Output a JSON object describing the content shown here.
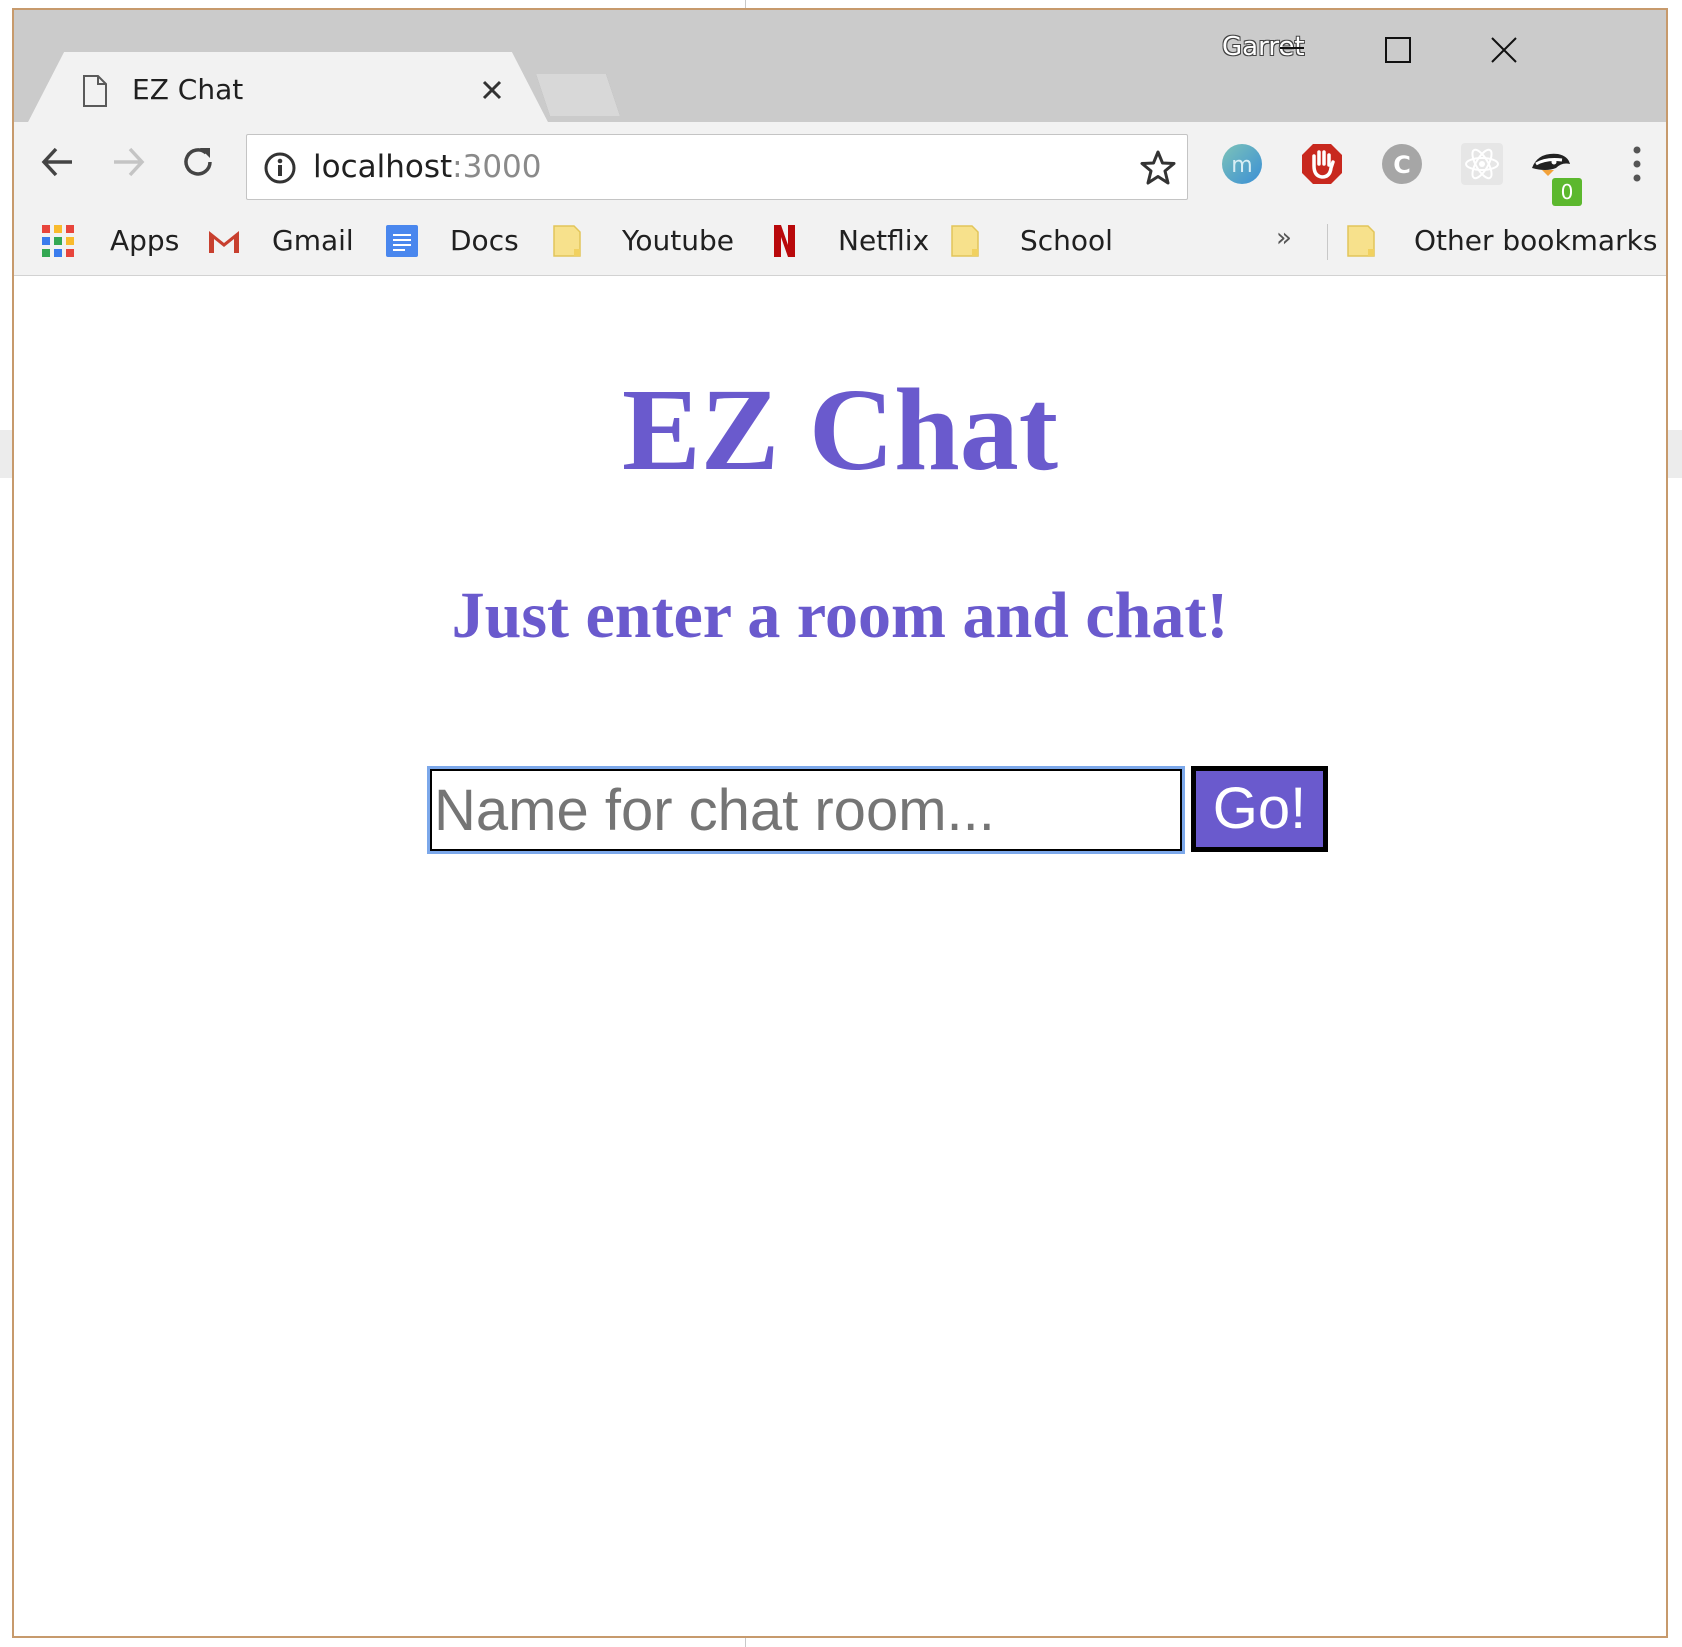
{
  "browser": {
    "tab_title": "EZ Chat",
    "profile_name": "Garret",
    "address": {
      "host": "localhost",
      "port": ":3000"
    },
    "extension_badge": "0",
    "bookmarks": [
      {
        "label": "Apps",
        "icon": "apps-grid-icon"
      },
      {
        "label": "Gmail",
        "icon": "gmail-icon"
      },
      {
        "label": "Docs",
        "icon": "docs-icon"
      },
      {
        "label": "Youtube",
        "icon": "folder-icon"
      },
      {
        "label": "Netflix",
        "icon": "netflix-icon"
      },
      {
        "label": "School",
        "icon": "folder-icon"
      }
    ],
    "overflow_label": "»",
    "other_bookmarks": "Other bookmarks"
  },
  "page": {
    "title": "EZ Chat",
    "subtitle": "Just enter a room and chat!",
    "room_input": {
      "placeholder": "Name for chat room...",
      "value": ""
    },
    "go_label": "Go!",
    "accent_color": "#6a5acd"
  }
}
